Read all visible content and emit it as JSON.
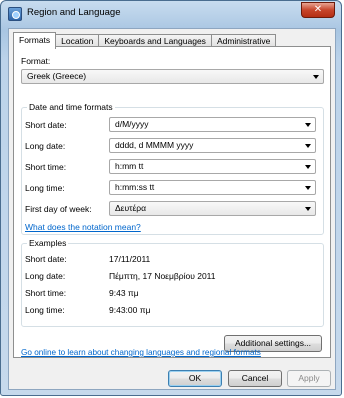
{
  "window": {
    "title": "Region and Language",
    "close_glyph": "✕"
  },
  "tabs": [
    {
      "label": "Formats",
      "active": true
    },
    {
      "label": "Location",
      "active": false
    },
    {
      "label": "Keyboards and Languages",
      "active": false
    },
    {
      "label": "Administrative",
      "active": false
    }
  ],
  "format": {
    "label": "Format:",
    "value": "Greek (Greece)"
  },
  "datetime": {
    "group_title": "Date and time formats",
    "rows": [
      {
        "label": "Short date:",
        "value": "d/M/yyyy"
      },
      {
        "label": "Long date:",
        "value": "dddd, d MMMM yyyy"
      },
      {
        "label": "Short time:",
        "value": "h:mm tt"
      },
      {
        "label": "Long time:",
        "value": "h:mm:ss tt"
      },
      {
        "label": "First day of week:",
        "value": "Δευτέρα"
      }
    ],
    "notation_link": "What does the notation mean?"
  },
  "examples": {
    "group_title": "Examples",
    "rows": [
      {
        "label": "Short date:",
        "value": "17/11/2011"
      },
      {
        "label": "Long date:",
        "value": "Πέμπτη, 17 Νοεμβρίου 2011"
      },
      {
        "label": "Short time:",
        "value": "9:43 πμ"
      },
      {
        "label": "Long time:",
        "value": "9:43:00 πμ"
      }
    ]
  },
  "additional_settings": "Additional settings...",
  "online_link": "Go online to learn about changing languages and regional formats",
  "buttons": {
    "ok": "OK",
    "cancel": "Cancel",
    "apply": "Apply"
  }
}
